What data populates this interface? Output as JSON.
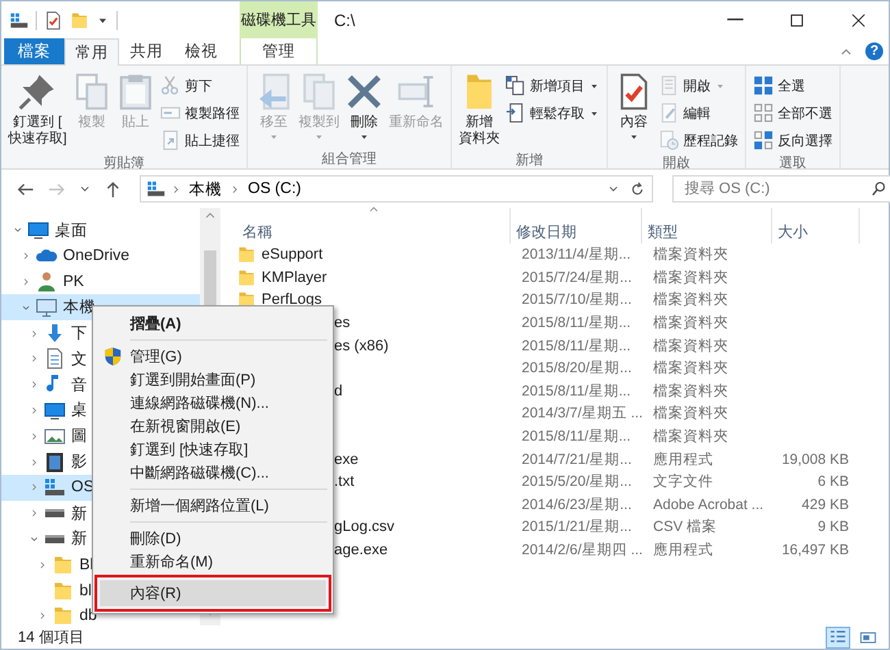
{
  "window": {
    "context_tab": "磁碟機工具",
    "title": "C:\\",
    "help": "?"
  },
  "tabs": [
    {
      "label": "檔案",
      "kind": "file",
      "selected": false
    },
    {
      "label": "常用",
      "kind": "tab",
      "selected": true
    },
    {
      "label": "共用",
      "kind": "tab",
      "selected": false
    },
    {
      "label": "檢視",
      "kind": "tab",
      "selected": false
    },
    {
      "label": "管理",
      "kind": "context",
      "selected": false
    }
  ],
  "ribbon": {
    "groups": [
      {
        "label": "剪貼簿",
        "items": [
          {
            "kind": "pin",
            "lines": [
              "釘選到 [",
              "快速存取]"
            ],
            "disabled": false,
            "dropdown": false
          },
          {
            "kind": "copy",
            "lines": [
              "複製"
            ],
            "disabled": true,
            "dropdown": false
          },
          {
            "kind": "paste",
            "lines": [
              "貼上"
            ],
            "disabled": true,
            "dropdown": false
          },
          {
            "buttons": [
              {
                "kind": "cut",
                "label": "剪下",
                "disabled": true,
                "dropdown": false
              },
              {
                "kind": "copy-path",
                "label": "複製路徑",
                "disabled": true,
                "dropdown": false
              },
              {
                "kind": "paste-shortcut",
                "label": "貼上捷徑",
                "disabled": true,
                "dropdown": false
              }
            ]
          }
        ]
      },
      {
        "label": "組合管理",
        "items": [
          {
            "kind": "move",
            "lines": [
              "移至"
            ],
            "disabled": true,
            "dropdown": true
          },
          {
            "kind": "copy-to",
            "lines": [
              "複製到"
            ],
            "disabled": true,
            "dropdown": true
          },
          {
            "kind": "delete",
            "lines": [
              "刪除"
            ],
            "disabled": false,
            "dropdown": true
          },
          {
            "kind": "rename",
            "lines": [
              "重新命名"
            ],
            "disabled": true,
            "dropdown": false
          }
        ]
      },
      {
        "label": "新增",
        "items": [
          {
            "kind": "new-folder",
            "lines": [
              "新增",
              "資料夾"
            ],
            "disabled": false,
            "dropdown": false
          },
          {
            "buttons": [
              {
                "kind": "new-item",
                "label": "新增項目",
                "disabled": false,
                "dropdown": true
              },
              {
                "kind": "easy-access",
                "label": "輕鬆存取",
                "disabled": false,
                "dropdown": true
              }
            ]
          }
        ]
      },
      {
        "label": "開啟",
        "items": [
          {
            "kind": "properties",
            "lines": [
              "內容"
            ],
            "disabled": false,
            "dropdown": true
          },
          {
            "buttons": [
              {
                "kind": "open",
                "label": "開啟",
                "disabled": true,
                "dropdown": true
              },
              {
                "kind": "edit",
                "label": "編輯",
                "disabled": true,
                "dropdown": false
              },
              {
                "kind": "history",
                "label": "歷程記錄",
                "disabled": true,
                "dropdown": false
              }
            ]
          }
        ]
      },
      {
        "label": "選取",
        "items": [
          {
            "buttons": [
              {
                "kind": "select-all",
                "label": "全選",
                "disabled": false,
                "dropdown": false
              },
              {
                "kind": "select-none",
                "label": "全部不選",
                "disabled": false,
                "dropdown": false
              },
              {
                "kind": "invert",
                "label": "反向選擇",
                "disabled": false,
                "dropdown": false
              }
            ]
          }
        ]
      }
    ]
  },
  "nav_buttons": [
    {
      "kind": "back",
      "disabled": false
    },
    {
      "kind": "forward",
      "disabled": true
    },
    {
      "kind": "recent",
      "disabled": false
    },
    {
      "kind": "up",
      "disabled": false
    }
  ],
  "address": {
    "breadcrumb": [
      "本機",
      "OS (C:)"
    ]
  },
  "search": {
    "placeholder": "搜尋 OS (C:)"
  },
  "tree": [
    {
      "label": "桌面",
      "kind": "desktop",
      "expanded": true,
      "selected": false,
      "children": [
        {
          "label": "OneDrive",
          "kind": "cloud",
          "expanded": false,
          "selected": false
        },
        {
          "label": "PK",
          "kind": "person",
          "expanded": false,
          "selected": false
        },
        {
          "label": "本機",
          "kind": "computer",
          "expanded": true,
          "selected": true,
          "children": [
            {
              "label": "下",
              "kind": "download",
              "expanded": false,
              "selected": false
            },
            {
              "label": "文",
              "kind": "document",
              "expanded": false,
              "selected": false
            },
            {
              "label": "音",
              "kind": "music",
              "expanded": false,
              "selected": false
            },
            {
              "label": "桌",
              "kind": "desktop",
              "expanded": false,
              "selected": false
            },
            {
              "label": "圖",
              "kind": "picture",
              "expanded": false,
              "selected": false
            },
            {
              "label": "影",
              "kind": "film",
              "expanded": false,
              "selected": false
            },
            {
              "label": "OS",
              "kind": "system",
              "expanded": false,
              "selected": true
            },
            {
              "label": "新",
              "kind": "drive",
              "expanded": false,
              "selected": false
            },
            {
              "label": "新",
              "kind": "drive",
              "expanded": true,
              "selected": false,
              "children": [
                {
                  "label": "Bl",
                  "kind": "folder",
                  "expanded": false,
                  "selected": false
                },
                {
                  "label": "bl",
                  "kind": "folder",
                  "selected": false
                },
                {
                  "label": "db",
                  "kind": "folder",
                  "expanded": false,
                  "selected": false
                }
              ]
            }
          ]
        }
      ]
    }
  ],
  "columns": [
    {
      "label": "名稱",
      "sorted": true
    },
    {
      "label": "修改日期",
      "sorted": false
    },
    {
      "label": "類型",
      "sorted": false
    },
    {
      "label": "大小",
      "sorted": false
    }
  ],
  "rows": [
    {
      "name": "eSupport",
      "kind": "folder",
      "covered": false,
      "modified": "2013/11/4/星期...",
      "type": "檔案資料夾"
    },
    {
      "name": "KMPlayer",
      "kind": "folder",
      "covered": false,
      "modified": "2015/7/24/星期...",
      "type": "檔案資料夾"
    },
    {
      "name": "PerfLogs",
      "kind": "folder",
      "covered": false,
      "modified": "2015/7/10/星期...",
      "type": "檔案資料夾"
    },
    {
      "name": "es",
      "covered": true,
      "modified": "2015/8/11/星期...",
      "type": "檔案資料夾"
    },
    {
      "name": "es (x86)",
      "covered": true,
      "modified": "2015/8/11/星期...",
      "type": "檔案資料夾"
    },
    {
      "modified": "2015/8/20/星期...",
      "type": "檔案資料夾"
    },
    {
      "name": "d",
      "covered": true,
      "modified": "2015/8/11/星期...",
      "type": "檔案資料夾"
    },
    {
      "modified": "2014/3/7/星期五 ...",
      "type": "檔案資料夾"
    },
    {
      "modified": "2015/8/11/星期...",
      "type": "檔案資料夾"
    },
    {
      "name": "exe",
      "covered": true,
      "modified": "2014/7/21/星期...",
      "type": "應用程式",
      "size": "19,008 KB"
    },
    {
      "name": ".txt",
      "covered": true,
      "modified": "2015/5/20/星期...",
      "type": "文字文件",
      "size": "6 KB"
    },
    {
      "modified": "2014/6/23/星期...",
      "type": "Adobe Acrobat ...",
      "size": "429 KB"
    },
    {
      "name": "gLog.csv",
      "covered": true,
      "modified": "2015/1/21/星期...",
      "type": "CSV 檔案",
      "size": "9 KB"
    },
    {
      "name": "age.exe",
      "covered": true,
      "modified": "2014/2/6/星期四 ...",
      "type": "應用程式",
      "size": "16,497 KB"
    }
  ],
  "context_menu": [
    {
      "kind": "item",
      "label": "摺疊(A)",
      "default": true,
      "highlighted": false,
      "outlined": false
    },
    {
      "kind": "separator"
    },
    {
      "kind": "admin",
      "label": "管理(G)",
      "default": false,
      "highlighted": false,
      "outlined": false
    },
    {
      "kind": "item",
      "label": "釘選到開始畫面(P)",
      "default": false,
      "highlighted": false,
      "outlined": false
    },
    {
      "kind": "item",
      "label": "連線網路磁碟機(N)...",
      "default": false,
      "highlighted": false,
      "outlined": false
    },
    {
      "kind": "item",
      "label": "在新視窗開啟(E)",
      "default": false,
      "highlighted": false,
      "outlined": false
    },
    {
      "kind": "item",
      "label": "釘選到 [快速存取]",
      "default": false,
      "highlighted": false,
      "outlined": false
    },
    {
      "kind": "item",
      "label": "中斷網路磁碟機(C)...",
      "default": false,
      "highlighted": false,
      "outlined": false
    },
    {
      "kind": "separator"
    },
    {
      "kind": "item",
      "label": "新增一個網路位置(L)",
      "default": false,
      "highlighted": false,
      "outlined": false
    },
    {
      "kind": "separator"
    },
    {
      "kind": "item",
      "label": "刪除(D)",
      "default": false,
      "highlighted": false,
      "outlined": false
    },
    {
      "kind": "item",
      "label": "重新命名(M)",
      "default": false,
      "highlighted": false,
      "outlined": false
    },
    {
      "kind": "item",
      "label": "內容(R)",
      "default": false,
      "highlighted": true,
      "outlined": true
    }
  ],
  "status_bar": {
    "item_count": "14 個項目",
    "views": [
      {
        "kind": "details",
        "selected": true
      },
      {
        "kind": "tiles",
        "selected": false
      }
    ]
  }
}
